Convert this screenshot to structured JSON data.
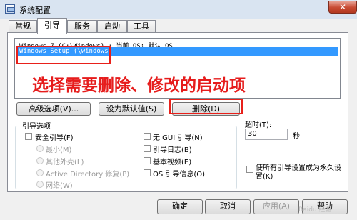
{
  "window": {
    "title": "系统配置",
    "close_glyph": "✕"
  },
  "tabs": [
    {
      "label": "常规"
    },
    {
      "label": "引导"
    },
    {
      "label": "服务"
    },
    {
      "label": "启动"
    },
    {
      "label": "工具"
    }
  ],
  "os_list": [
    "Windows 7 (C:\\Windows) : 当前 OS; 默认 OS",
    "Windows Setup (\\windows)"
  ],
  "selected_index": 1,
  "overlay_text": "选择需要删除、修改的启动项",
  "buttons": {
    "advanced": "高级选项(V)...",
    "set_default": "设为默认值(S)",
    "delete": "删除(D)"
  },
  "boot_options": {
    "group_label": "引导选项",
    "safe_boot": "安全引导(F)",
    "minimal": "最小(M)",
    "alternate_shell": "其他外壳(L)",
    "active_directory": "Active Directory 修复(P)",
    "network": "网络(W)",
    "no_gui": "无 GUI 引导(N)",
    "boot_log": "引导日志(B)",
    "base_video": "基本视频(E)",
    "os_boot_info": "OS 引导信息(O)"
  },
  "timeout": {
    "label": "超时(T):",
    "value": "30",
    "unit": "秒"
  },
  "make_permanent": "使所有引导设置成为永久设置(K)",
  "footer": {
    "ok": "确定",
    "cancel": "取消",
    "apply": "应用(A)",
    "help": "帮助"
  },
  "watermark": "Baidu 经验"
}
